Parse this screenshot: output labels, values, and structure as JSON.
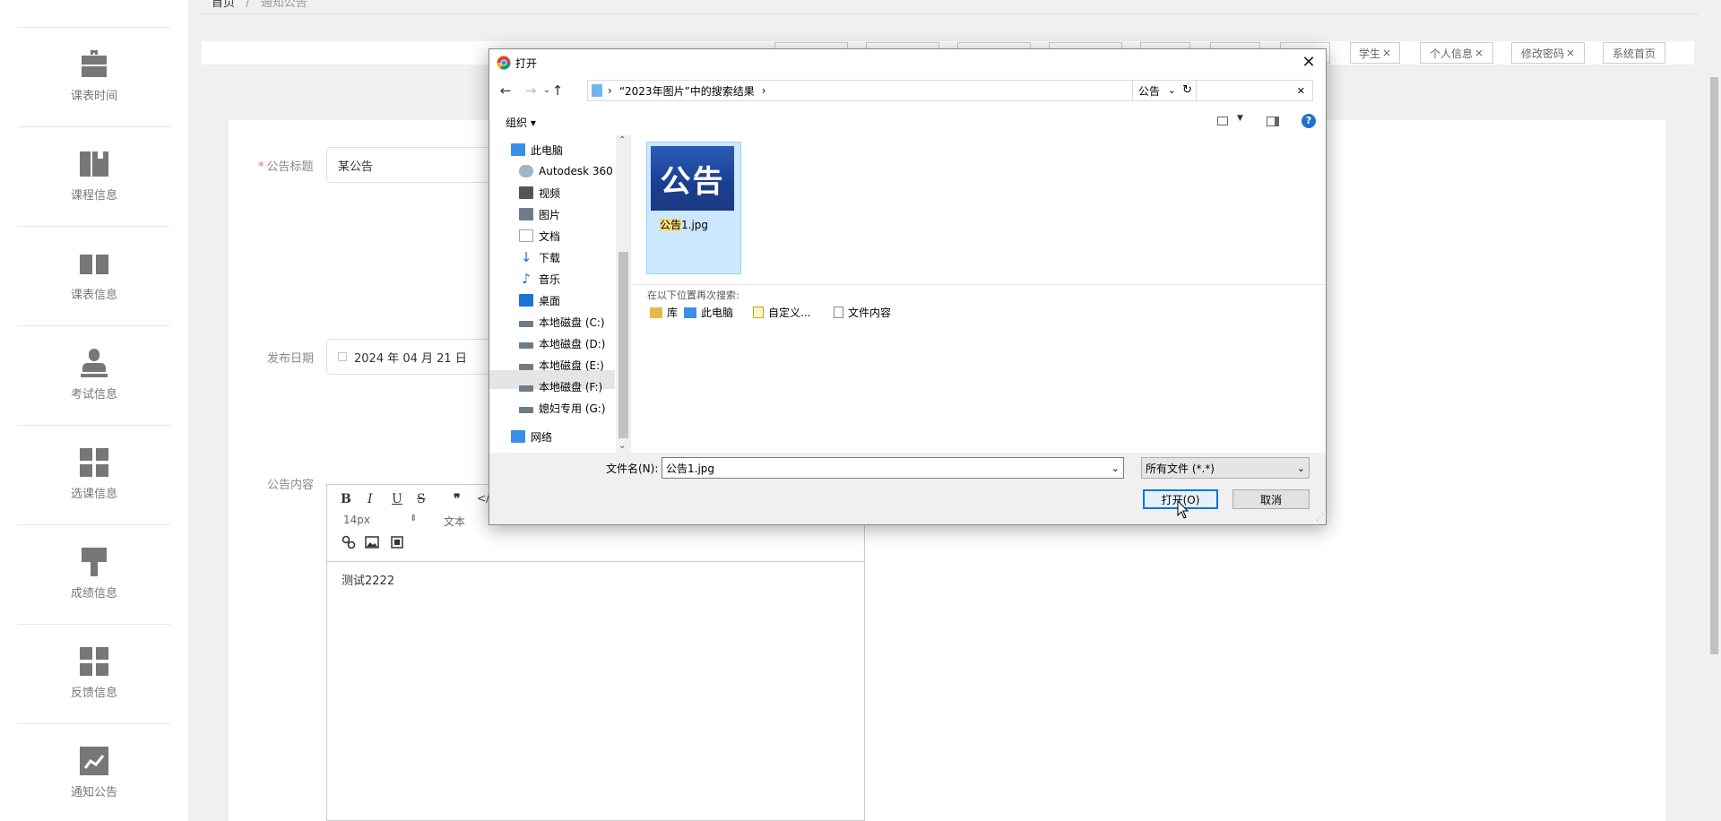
{
  "breadcrumb": {
    "home": "首页",
    "sep": "/",
    "current": "通知公告"
  },
  "sidebar": {
    "items": [
      {
        "label": "课表时间",
        "icon": "briefcase-icon"
      },
      {
        "label": "课程信息",
        "icon": "book-icon"
      },
      {
        "label": "课表信息",
        "icon": "ticket-icon"
      },
      {
        "label": "考试信息",
        "icon": "person-icon"
      },
      {
        "label": "选课信息",
        "icon": "grid-icon"
      },
      {
        "label": "成绩信息",
        "icon": "brush-icon"
      },
      {
        "label": "反馈信息",
        "icon": "grid-icon"
      },
      {
        "label": "通知公告",
        "icon": "chart-icon"
      }
    ]
  },
  "tags": [
    {
      "label": "学生",
      "closable": true
    },
    {
      "label": "个人信息",
      "closable": true
    },
    {
      "label": "修改密码",
      "closable": true
    },
    {
      "label": "系统首页",
      "closable": false
    }
  ],
  "form": {
    "title_label": "公告标题",
    "required_mark": "*",
    "title_value": "某公告",
    "date_label": "发布日期",
    "date_value": "2024 年 04 月 21 日",
    "content_label": "公告内容",
    "editor": {
      "bold": "B",
      "italic": "I",
      "underline": "U",
      "strike": "S",
      "quote": "❞",
      "code": "</>",
      "font_size": "14px",
      "text_style": "文本",
      "content": "测试2222"
    }
  },
  "dialog": {
    "title": "打开",
    "close": "✕",
    "path_root": "›",
    "path_label": "“2023年图片”中的搜索结果",
    "path_sep": "›",
    "search_value": "公告",
    "search_clear": "✕",
    "organize": "组织 ▾",
    "help": "?",
    "tree": [
      {
        "label": "此电脑",
        "color": "#3a8ee6"
      },
      {
        "label": "Autodesk 360",
        "color": "#9fb4c7"
      },
      {
        "label": "视频",
        "color": "#555555"
      },
      {
        "label": "图片",
        "color": "#6d7d8f"
      },
      {
        "label": "文档",
        "color": "#9aa3ad"
      },
      {
        "label": "下载",
        "color": "#1f6fd1"
      },
      {
        "label": "音乐",
        "color": "#1f6fd1"
      },
      {
        "label": "桌面",
        "color": "#1a73d9"
      },
      {
        "label": "本地磁盘 (C:)",
        "color": "#6e7b88"
      },
      {
        "label": "本地磁盘 (D:)",
        "color": "#6e7b88"
      },
      {
        "label": "本地磁盘 (E:)",
        "color": "#6e7b88"
      },
      {
        "label": "本地磁盘 (F:)",
        "color": "#6e7b88"
      },
      {
        "label": "媳妇专用 (G:)",
        "color": "#6e7b88"
      },
      {
        "label": "网络",
        "color": "#3a8ee6"
      }
    ],
    "selected_tree": "本地磁盘 (E:)",
    "file": {
      "thumb_text": "公告",
      "name_highlight": "公告",
      "name_rest": "1.jpg"
    },
    "search_again_label": "在以下位置再次搜索:",
    "search_again": [
      "库",
      "此电脑",
      "自定义...",
      "文件内容"
    ],
    "filename_label": "文件名(N):",
    "filename_value": "公告1.jpg",
    "filetype_value": "所有文件 (*.*)",
    "open_button": "打开(O)",
    "cancel_button": "取消"
  }
}
